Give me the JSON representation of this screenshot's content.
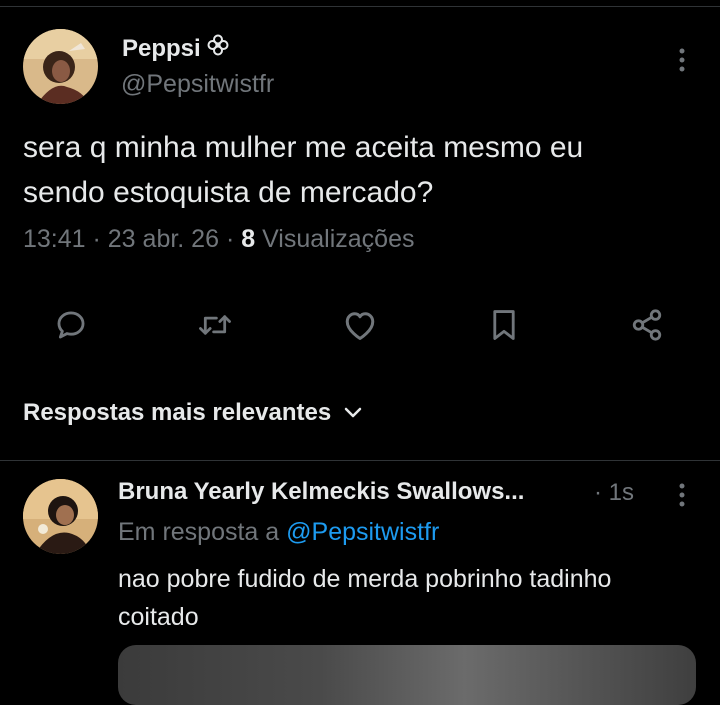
{
  "tweet": {
    "author_name": "Peppsi",
    "author_badge_icon": "flower-emoji-icon",
    "author_handle": "@Pepsitwistfr",
    "text_line1": "sera q minha mulher me aceita mesmo eu",
    "text_line2": "sendo estoquista de mercado?",
    "time": "13:41",
    "sep1": " · ",
    "date": "23 abr. 26",
    "sep2": " · ",
    "view_count": "8",
    "view_label": " Visualizações"
  },
  "actions": [
    "reply-icon",
    "retweet-icon",
    "heart-icon",
    "bookmark-icon",
    "share-icon"
  ],
  "replies_section": {
    "sort_label": "Respostas mais relevantes",
    "sort_icon": "chevron-down-icon"
  },
  "reply": {
    "author_name": "Bruna Yearly Kelmeckis Swallows...",
    "time_label": "· 1s",
    "reply_to_prefix": "Em resposta a ",
    "reply_to_handle": "@Pepsitwistfr",
    "text_line1": "nao pobre fudido de merda pobrinho tadinho",
    "text_line2": "coitado"
  },
  "colors": {
    "background": "#000000",
    "primary_text": "#e7e9ea",
    "secondary_text": "#71767b",
    "accent": "#1d9bf0",
    "divider": "#2f3336"
  }
}
